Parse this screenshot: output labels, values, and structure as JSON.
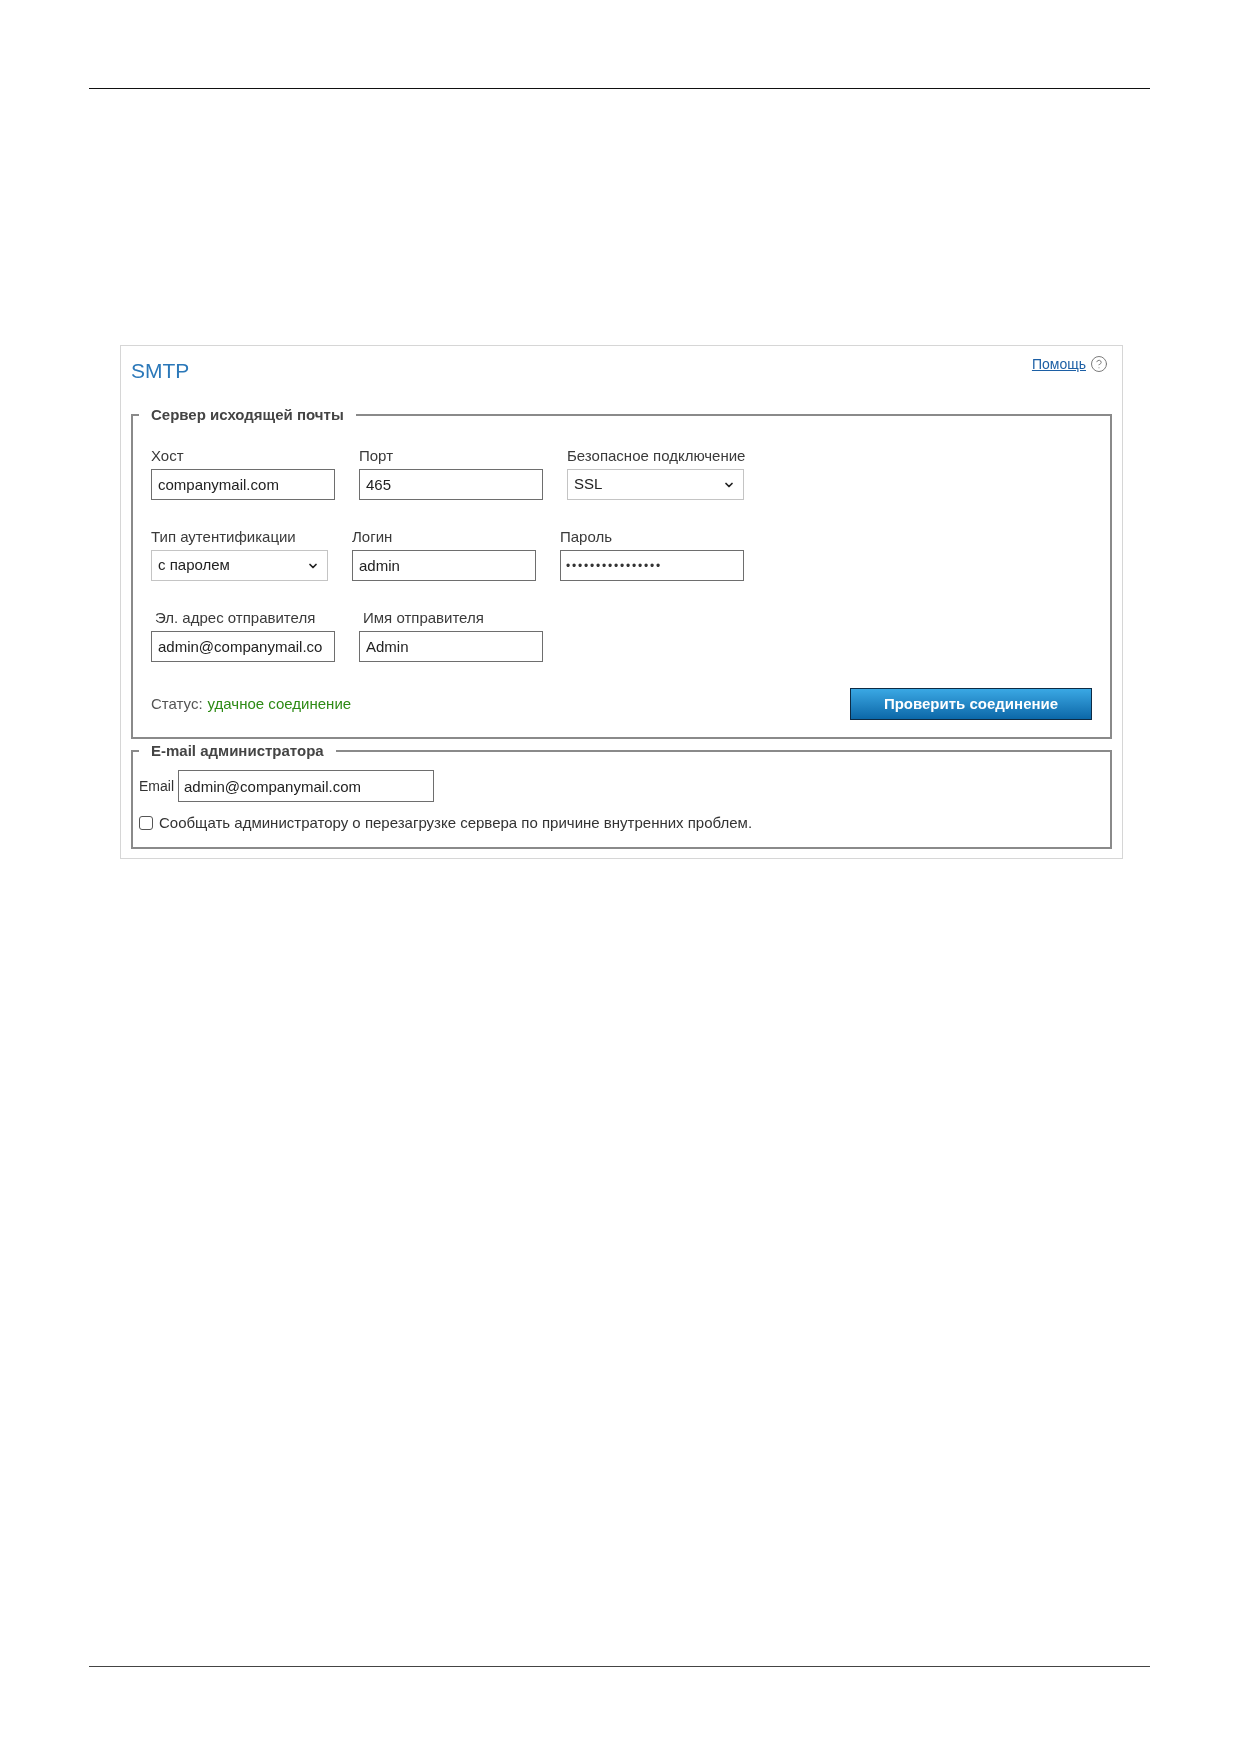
{
  "panel": {
    "title": "SMTP",
    "help_link": "Помощь"
  },
  "outgoing_server": {
    "legend": "Сервер исходящей почты",
    "rows": [
      [
        {
          "kind": "input",
          "label": "Хост",
          "value": "companymail.com"
        },
        {
          "kind": "input",
          "label": "Порт",
          "value": "465"
        },
        {
          "kind": "select",
          "label": "Безопасное подключение",
          "value": "SSL"
        }
      ],
      [
        {
          "kind": "select",
          "label": "Тип аутентификации",
          "value": "с паролем"
        },
        {
          "kind": "input",
          "label": "Логин",
          "value": "admin"
        },
        {
          "kind": "password",
          "label": "Пароль",
          "value": "••••••••••••••••"
        }
      ],
      [
        {
          "kind": "input",
          "label": "Эл. адрес отправителя",
          "value": "admin@companymail.co"
        },
        {
          "kind": "input",
          "label": "Имя отправителя",
          "value": "Admin"
        }
      ]
    ],
    "status": {
      "label": "Статус:",
      "value": "удачное соединение"
    },
    "test_button": "Проверить соединение"
  },
  "admin_email": {
    "legend": "E-mail администратора",
    "email_label": "Email",
    "email_value": "admin@companymail.com",
    "notify": {
      "label": "Сообщать администратору о перезагрузке сервера по причине внутренних проблем.",
      "checked": false
    }
  }
}
